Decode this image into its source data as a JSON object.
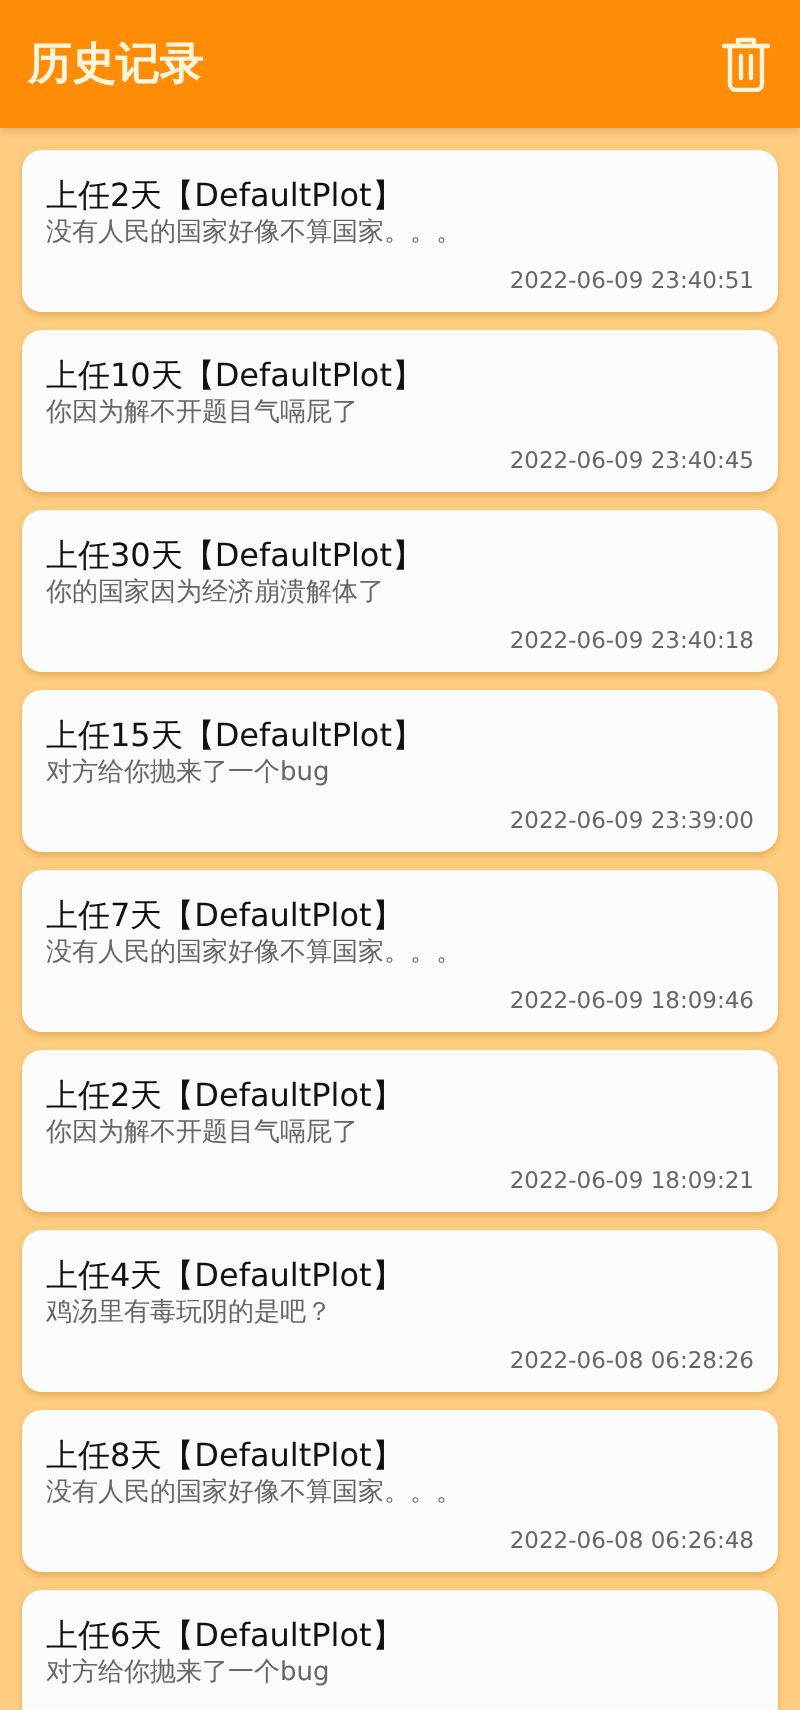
{
  "header": {
    "title": "历史记录"
  },
  "records": [
    {
      "title": "上任2天【DefaultPlot】",
      "message": "没有人民的国家好像不算国家。。。",
      "time": "2022-06-09 23:40:51"
    },
    {
      "title": "上任10天【DefaultPlot】",
      "message": "你因为解不开题目气嗝屁了",
      "time": "2022-06-09 23:40:45"
    },
    {
      "title": "上任30天【DefaultPlot】",
      "message": "你的国家因为经济崩溃解体了",
      "time": "2022-06-09 23:40:18"
    },
    {
      "title": "上任15天【DefaultPlot】",
      "message": "对方给你抛来了一个bug",
      "time": "2022-06-09 23:39:00"
    },
    {
      "title": "上任7天【DefaultPlot】",
      "message": "没有人民的国家好像不算国家。。。",
      "time": "2022-06-09 18:09:46"
    },
    {
      "title": "上任2天【DefaultPlot】",
      "message": "你因为解不开题目气嗝屁了",
      "time": "2022-06-09 18:09:21"
    },
    {
      "title": "上任4天【DefaultPlot】",
      "message": "鸡汤里有毒玩阴的是吧？",
      "time": "2022-06-08 06:28:26"
    },
    {
      "title": "上任8天【DefaultPlot】",
      "message": "没有人民的国家好像不算国家。。。",
      "time": "2022-06-08 06:26:48"
    },
    {
      "title": "上任6天【DefaultPlot】",
      "message": "对方给你抛来了一个bug"
    }
  ]
}
